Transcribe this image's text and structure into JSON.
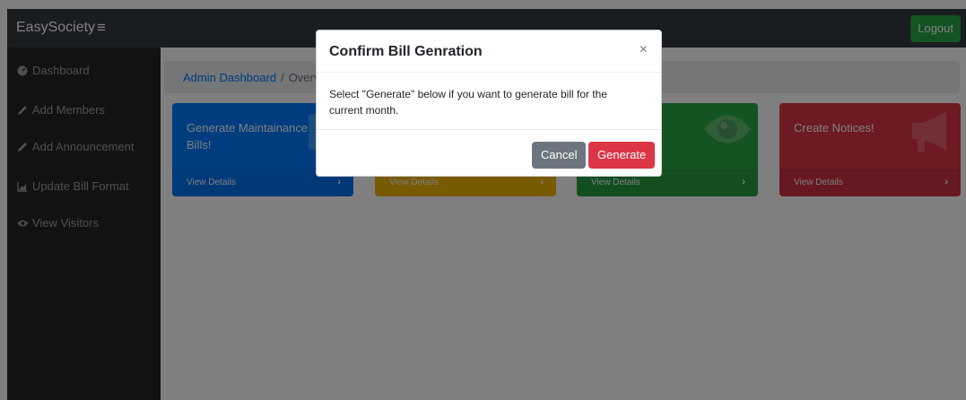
{
  "navbar": {
    "brand": "EasySociety",
    "toggle_icon": "menu-icon",
    "logout_label": "Logout"
  },
  "sidebar": {
    "items": [
      {
        "label": "Dashboard",
        "icon": "dashboard-icon"
      },
      {
        "label": "Add Members",
        "icon": "edit-icon"
      },
      {
        "label": "Add Announcement",
        "icon": "edit-icon"
      },
      {
        "label": "Update Bill Format",
        "icon": "chart-icon"
      },
      {
        "label": "View Visitors",
        "icon": "eye-icon"
      }
    ]
  },
  "breadcrumb": {
    "link": "Admin Dashboard",
    "separator": "/",
    "current": "Overview"
  },
  "cards": [
    {
      "title": "Generate Maintainance Bills!",
      "footer": "View Details",
      "color": "#007bff"
    },
    {
      "title": "",
      "footer": "View Details",
      "color": "#ffc107"
    },
    {
      "title": "",
      "footer": "View Details",
      "color": "#28a745"
    },
    {
      "title": "Create Notices!",
      "footer": "View Details",
      "color": "#dc3545"
    }
  ],
  "modal": {
    "title": "Confirm Bill Genration",
    "close_glyph": "×",
    "body": "Select \"Generate\" below if you want to generate bill for the current month.",
    "cancel_label": "Cancel",
    "generate_label": "Generate"
  },
  "colors": {
    "navbar_bg": "#343a40",
    "sidebar_bg": "#212529",
    "logout": "#28a745",
    "cancel": "#6c757d",
    "generate": "#dc3545"
  }
}
